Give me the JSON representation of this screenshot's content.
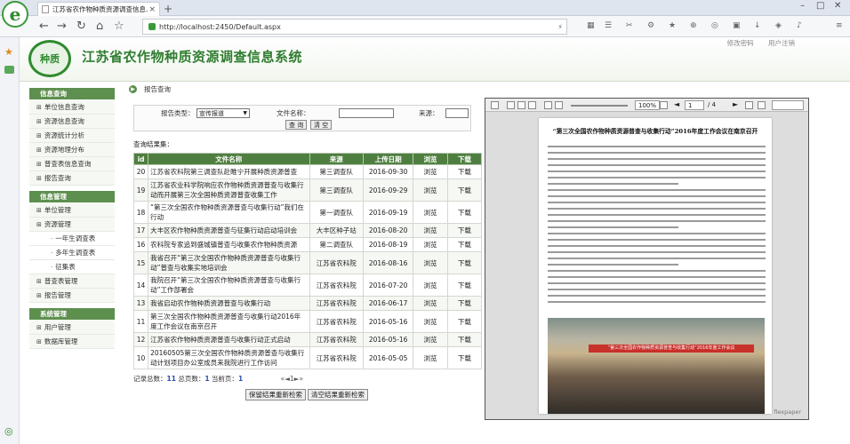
{
  "browser": {
    "tab_title": "江苏省农作物种质资源调查信息...",
    "url": "http://localhost:2450/Default.aspx",
    "tab_close": "×",
    "new_tab": "+",
    "back": "←",
    "forward": "→",
    "refresh": "↻",
    "home": "⌂",
    "favorite": "☆"
  },
  "header": {
    "logo_text": "种质",
    "site_title": "江苏省农作物种质资源调查信息系统",
    "links": [
      "修改密码",
      "用户注销"
    ]
  },
  "breadcrumb": "报告查询",
  "sidebar": {
    "sections": [
      {
        "title": "信息查询",
        "items": [
          {
            "label": "单位信息查询",
            "sub": false
          },
          {
            "label": "资源信息查询",
            "sub": false
          },
          {
            "label": "资源统计分析",
            "sub": false
          },
          {
            "label": "资源地理分布",
            "sub": false
          },
          {
            "label": "普查表信息查询",
            "sub": false
          },
          {
            "label": "报告查询",
            "sub": false
          }
        ]
      },
      {
        "title": "信息管理",
        "items": [
          {
            "label": "单位管理",
            "sub": false
          },
          {
            "label": "资源管理",
            "sub": false
          },
          {
            "label": "一年生调查表",
            "sub": true
          },
          {
            "label": "多年生调查表",
            "sub": true
          },
          {
            "label": "征集表",
            "sub": true
          },
          {
            "label": "普查表管理",
            "sub": false
          },
          {
            "label": "报告管理",
            "sub": false
          }
        ]
      },
      {
        "title": "系统管理",
        "items": [
          {
            "label": "用户管理",
            "sub": false
          },
          {
            "label": "数据库管理",
            "sub": false
          }
        ]
      }
    ]
  },
  "form": {
    "type_label": "报告类型：",
    "type_value": "宣传报道",
    "name_label": "文件名称：",
    "name_value": "",
    "source_label": "来源：",
    "source_value": "",
    "query_btn": "查 询",
    "clear_btn": "清 空"
  },
  "results_label": "查询结果集：",
  "table": {
    "headers": [
      "id",
      "文件名称",
      "来源",
      "上传日期",
      "浏览",
      "下载"
    ],
    "rows": [
      [
        "20",
        "江苏省农科院第三调查队赴睢宁开展种质资源普查",
        "第三调查队",
        "2016-09-30",
        "浏览",
        "下载"
      ],
      [
        "19",
        "江苏省农业科学院响应农作物种质资源普查与收集行动而开展第三次全国种质资源普查收集工作",
        "第三调查队",
        "2016-09-29",
        "浏览",
        "下载"
      ],
      [
        "18",
        "“第三次全国农作物种质资源普查与收集行动”我们在行动",
        "第一调查队",
        "2016-09-19",
        "浏览",
        "下载"
      ],
      [
        "17",
        "大丰区农作物种质资源普查与征集行动启动培训会",
        "大丰区种子站",
        "2016-08-20",
        "浏览",
        "下载"
      ],
      [
        "16",
        "农科院专家追到盛城镇普查与收集农作物种质资源",
        "第二调查队",
        "2016-08-19",
        "浏览",
        "下载"
      ],
      [
        "15",
        "我省召开“第三次全国农作物种质资源普查与收集行动”普查与收集实地培训会",
        "江苏省农科院",
        "2016-08-16",
        "浏览",
        "下载"
      ],
      [
        "14",
        "我院召开“第三次全国农作物种质资源普查与收集行动”工作部署会",
        "江苏省农科院",
        "2016-07-20",
        "浏览",
        "下载"
      ],
      [
        "13",
        "我省启动农作物种质资源普查与收集行动",
        "江苏省农科院",
        "2016-06-17",
        "浏览",
        "下载"
      ],
      [
        "11",
        "第三次全国农作物种质资源普查与收集行动2016年度工作会议在南京召开",
        "江苏省农科院",
        "2016-05-16",
        "浏览",
        "下载"
      ],
      [
        "12",
        "江苏省农作物种质资源普查与收集行动正式启动",
        "江苏省农科院",
        "2016-05-16",
        "浏览",
        "下载"
      ],
      [
        "10",
        "20160505第三次全国农作物种质资源普查与收集行动计划项目办公室成员来我院进行工作访问",
        "江苏省农科院",
        "2016-05-05",
        "浏览",
        "下载"
      ]
    ]
  },
  "pager": {
    "total_label": "记录总数：",
    "total": "11",
    "pages_label": " 总页数：",
    "pages": "1",
    "current_label": " 当前页：",
    "current": "1",
    "controls": "«◄1►»"
  },
  "buttons": {
    "save_research": "保留结果重新检索",
    "clear_research": "清空结果重新检索"
  },
  "viewer": {
    "zoom": "100%",
    "page": "1",
    "page_total": "/ 4",
    "doc_title": "“第三次全国农作物种质资源普查与收集行动”2016年度工作会议在南京召开",
    "photo_banner": "“第三次全国农作物种质资源普查与收集行动”2016年度工作会议",
    "brand": "flexpaper"
  }
}
